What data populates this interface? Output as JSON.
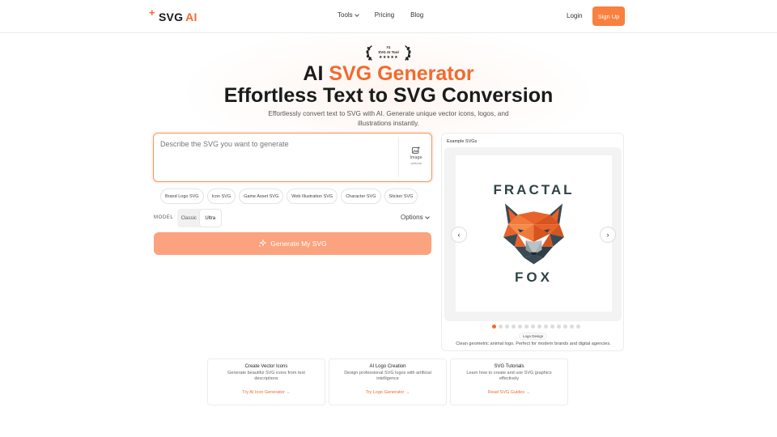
{
  "header": {
    "logo_text": "SVG",
    "logo_accent": "AI",
    "logo_mark": "+",
    "nav": [
      {
        "label": "Tools",
        "has_dropdown": true
      },
      {
        "label": "Pricing"
      },
      {
        "label": "Blog"
      }
    ],
    "login": "Login",
    "signup": "Sign Up"
  },
  "badge": {
    "rank": "#1",
    "label": "SVG AI Tool",
    "stars": "★★★★★"
  },
  "hero": {
    "title_prefix": "AI",
    "title_accent": "SVG Generator",
    "subtitle": "Effortless Text to SVG Conversion",
    "description": "Effortlessly convert text to SVG with AI. Generate unique vector icons, logos, and illustrations instantly."
  },
  "prompt": {
    "placeholder": "Describe the SVG you want to generate",
    "value": "",
    "image_label": "Image",
    "image_optional": "optional"
  },
  "chips": [
    "Brand Logo SVG",
    "Icon SVG",
    "Game Asset SVG",
    "Web Illustration SVG",
    "Character SVG",
    "Sticker SVG"
  ],
  "model": {
    "label": "MODEL",
    "options": [
      "Classic",
      "Ultra"
    ],
    "selected": "Ultra"
  },
  "options_label": "Options",
  "generate_label": "Generate My SVG",
  "example": {
    "title": "Example SVGs",
    "image_text_top": "FRACTAL",
    "image_text_bottom": "FOX",
    "dot_count": 14,
    "active_dot": 0,
    "tag": "Logo Design",
    "caption": "Clean geometric animal logo. Perfect for modern brands and digital agencies.",
    "prev": "‹",
    "next": "›"
  },
  "features": [
    {
      "title": "Create Vector Icons",
      "description": "Generate beautiful SVG icons from text descriptions",
      "link": "Try AI Icon Generator →"
    },
    {
      "title": "AI Logo Creation",
      "description": "Design professional SVG logos with artificial intelligence",
      "link": "Try Logo Generator →"
    },
    {
      "title": "SVG Tutorials",
      "description": "Learn how to create and use SVG graphics effectively",
      "link": "Read SVG Guides →"
    }
  ],
  "colors": {
    "accent": "#f26a2e",
    "button": "#f9803f",
    "generate_button": "#fba27f",
    "fox_orange": "#e8622b",
    "fox_dark": "#3a4a52"
  }
}
